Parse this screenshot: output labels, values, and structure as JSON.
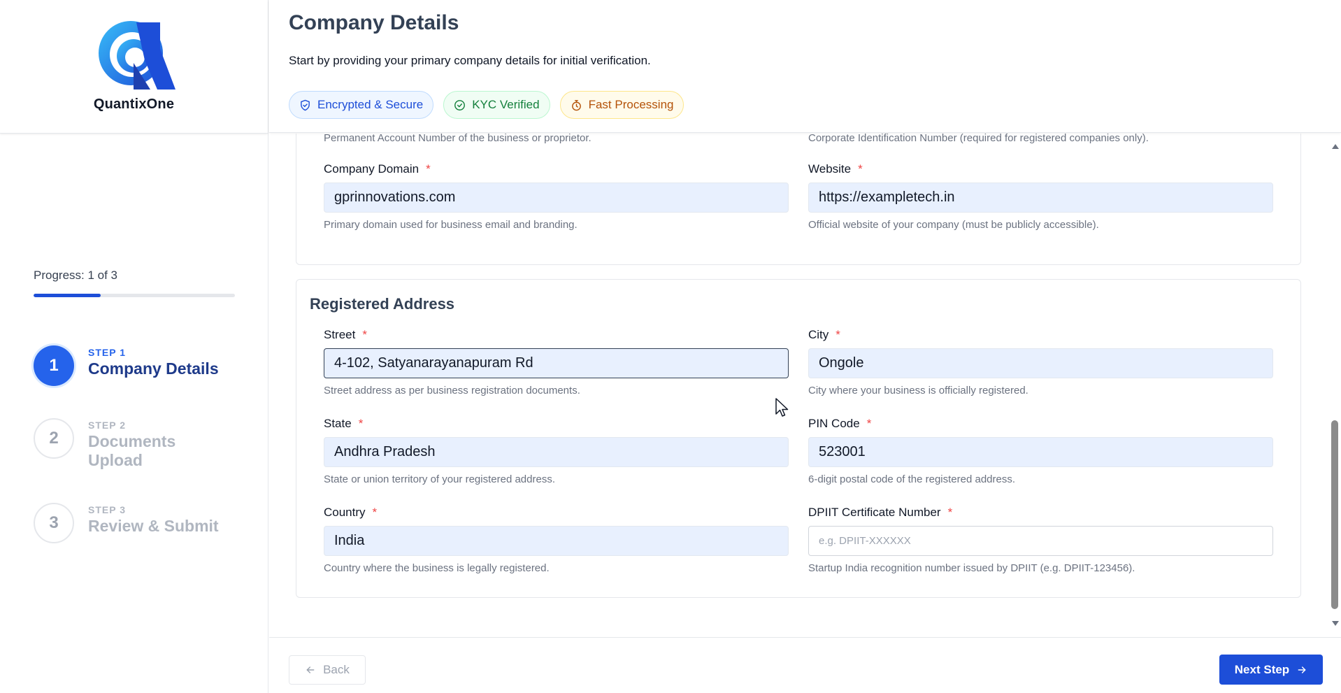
{
  "brand": {
    "name": "QuantixOne",
    "accent": "#1d4ed8"
  },
  "progress": {
    "label": "Progress: 1 of 3",
    "fraction": 0.333
  },
  "steps": [
    {
      "kicker": "STEP 1",
      "title": "Company Details",
      "number": "1",
      "state": "active"
    },
    {
      "kicker": "STEP 2",
      "title": "Documents Upload",
      "number": "2",
      "state": "inactive"
    },
    {
      "kicker": "STEP 3",
      "title": "Review & Submit",
      "number": "3",
      "state": "inactive"
    }
  ],
  "header": {
    "title": "Company Details",
    "subtitle": "Start by providing your primary company details for initial verification.",
    "badges": [
      {
        "label": "Encrypted & Secure",
        "icon": "shield-icon"
      },
      {
        "label": "KYC Verified",
        "icon": "check-circle-icon"
      },
      {
        "label": "Fast Processing",
        "icon": "stopwatch-icon"
      }
    ]
  },
  "company_section": {
    "pan_hint": "Permanent Account Number of the business or proprietor.",
    "cin_hint": "Corporate Identification Number (required for registered companies only).",
    "domain": {
      "label": "Company Domain",
      "value": "gprinnovations.com",
      "hint": "Primary domain used for business email and branding."
    },
    "website": {
      "label": "Website",
      "value": "https://exampletech.in",
      "hint": "Official website of your company (must be publicly accessible)."
    }
  },
  "address_section": {
    "title": "Registered Address",
    "street": {
      "label": "Street",
      "value": "4-102, Satyanarayanapuram Rd",
      "hint": "Street address as per business registration documents."
    },
    "city": {
      "label": "City",
      "value": "Ongole",
      "hint": "City where your business is officially registered."
    },
    "state": {
      "label": "State",
      "value": "Andhra Pradesh",
      "hint": "State or union territory of your registered address."
    },
    "pin": {
      "label": "PIN Code",
      "value": "523001",
      "hint": "6-digit postal code of the registered address."
    },
    "country": {
      "label": "Country",
      "value": "India",
      "hint": "Country where the business is legally registered."
    },
    "dpiit": {
      "label": "DPIIT Certificate Number",
      "value": "",
      "placeholder": "e.g. DPIIT-XXXXXX",
      "hint": "Startup India recognition number issued by DPIIT (e.g. DPIIT-123456)."
    }
  },
  "required_marker": "*",
  "footer": {
    "back_label": "Back",
    "next_label": "Next Step"
  }
}
